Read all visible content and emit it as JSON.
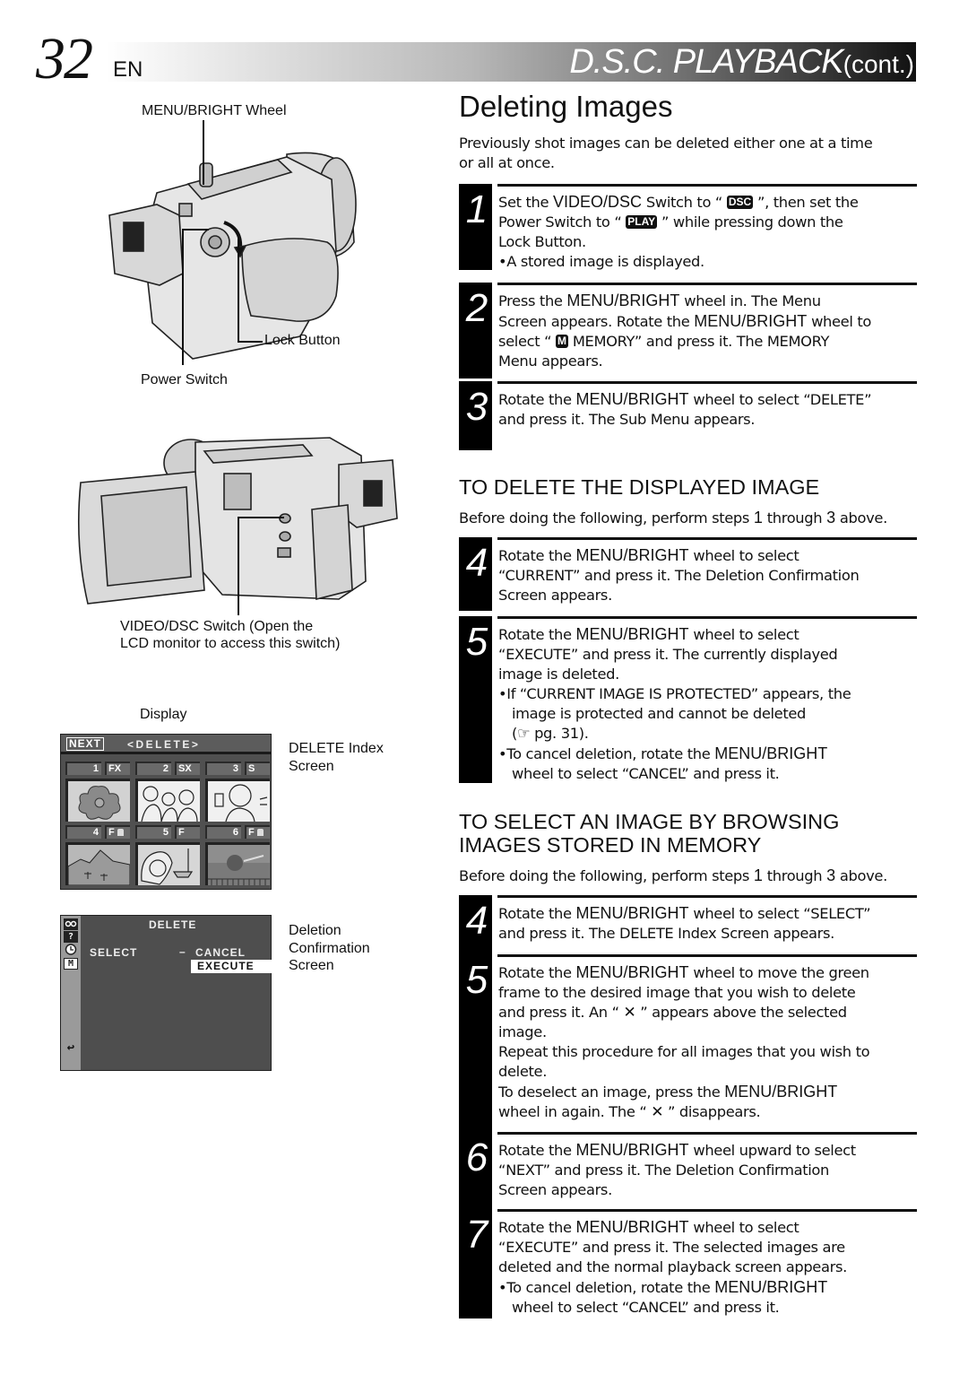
{
  "header": {
    "page_number": "32",
    "language": "EN",
    "section_title": "D.S.C.  PLAYBACK",
    "section_suffix": "(cont.)"
  },
  "figures": {
    "camera_top": {
      "label_wheel": "MENU/BRIGHT Wheel",
      "label_lock": "Lock Button",
      "label_power": "Power Switch"
    },
    "camera_lcd": {
      "label_switch_line1": "VIDEO/DSC Switch (Open the",
      "label_switch_line2": "LCD monitor to access this switch)"
    },
    "display_label": "Display",
    "delete_index_screen": {
      "caption_line1": "DELETE Index",
      "caption_line2": "Screen",
      "next_label": "NEXT",
      "title": "<DELETE>",
      "thumbnails": [
        {
          "number": "1",
          "mode": "FX",
          "protected": false,
          "subject": "flower"
        },
        {
          "number": "2",
          "mode": "SX",
          "protected": false,
          "subject": "group of people"
        },
        {
          "number": "3",
          "mode": "S",
          "protected": false,
          "subject": "woman with drink"
        },
        {
          "number": "4",
          "mode": "F",
          "protected": true,
          "subject": "mountains"
        },
        {
          "number": "5",
          "mode": "F",
          "protected": false,
          "subject": "woman with hat"
        },
        {
          "number": "6",
          "mode": "F",
          "protected": true,
          "subject": "sunset over sea"
        }
      ]
    },
    "confirmation_screen": {
      "caption_line1": "Deletion",
      "caption_line2": "Confirmation",
      "caption_line3": "Screen",
      "title": "DELETE",
      "left_option": "SELECT",
      "dash": "–",
      "options": [
        "CANCEL",
        "EXECUTE"
      ],
      "highlighted_option": "EXECUTE",
      "side_icons": [
        "tape-icon",
        "camera-question-icon",
        "clock-icon",
        "memory-icon",
        "return-icon"
      ],
      "memory_icon_glyph": "M",
      "return_icon_glyph": "↩"
    }
  },
  "main": {
    "title": "Deleting Images",
    "intro_line1": "Previously shot images can be deleted either one at a time",
    "intro_line2": "or all at once.",
    "steps_common": [
      {
        "number": "1",
        "lines": [
          [
            "Set the ",
            {
              "b": "VIDEO/DSC"
            },
            " Switch to “ ",
            {
              "chip": "DSC"
            },
            " ”, then set the"
          ],
          [
            "Power Switch to “ ",
            {
              "chip": "PLAY"
            },
            " ” while pressing down the"
          ],
          [
            "Lock Button."
          ],
          [
            "•A stored image is displayed."
          ]
        ]
      },
      {
        "number": "2",
        "lines": [
          [
            "Press the ",
            {
              "b": "MENU/BRIGHT"
            },
            " wheel in. The Menu"
          ],
          [
            "Screen appears. Rotate the ",
            {
              "b": "MENU/BRIGHT"
            },
            " wheel to"
          ],
          [
            "select “ ",
            {
              "chip": "M"
            },
            "  MEMORY” and press it. The MEMORY"
          ],
          [
            "Menu appears."
          ]
        ]
      },
      {
        "number": "3",
        "lines": [
          [
            "Rotate the ",
            {
              "b": "MENU/BRIGHT"
            },
            " wheel to select “DELETE”"
          ],
          [
            "and press it. The Sub Menu appears."
          ]
        ]
      }
    ],
    "section_current": {
      "heading": "TO DELETE THE DISPLAYED IMAGE",
      "note_parts": [
        "Before doing the following, perform steps ",
        "1",
        " through ",
        "3",
        " above."
      ],
      "steps": [
        {
          "number": "4",
          "lines": [
            [
              "Rotate the ",
              {
                "b": "MENU/BRIGHT"
              },
              " wheel to select"
            ],
            [
              "“CURRENT” and press it. The Deletion Confirmation"
            ],
            [
              "Screen appears."
            ]
          ]
        },
        {
          "number": "5",
          "lines": [
            [
              "Rotate the ",
              {
                "b": "MENU/BRIGHT"
              },
              " wheel to select"
            ],
            [
              "“EXECUTE” and press it. The currently displayed"
            ],
            [
              "image is deleted."
            ],
            [
              "•If “CURRENT IMAGE IS PROTECTED” appears, the"
            ],
            [
              {
                "ind": "image is protected and cannot be deleted"
              }
            ],
            [
              {
                "ind": "(☞ pg. 31)."
              }
            ],
            [
              "•To cancel deletion, rotate the ",
              {
                "b": "MENU/BRIGHT"
              }
            ],
            [
              {
                "ind": "wheel to select “CANCEL” and press it."
              }
            ]
          ]
        }
      ]
    },
    "section_browse": {
      "heading_line1": "TO SELECT AN IMAGE BY BROWSING",
      "heading_line2": "IMAGES STORED IN MEMORY",
      "note_parts": [
        "Before doing the following, perform steps ",
        "1",
        " through ",
        "3",
        " above."
      ],
      "steps": [
        {
          "number": "4",
          "lines": [
            [
              "Rotate the ",
              {
                "b": "MENU/BRIGHT"
              },
              " wheel to select “SELECT”"
            ],
            [
              "and press it. The DELETE Index Screen appears."
            ]
          ]
        },
        {
          "number": "5",
          "lines": [
            [
              "Rotate the ",
              {
                "b": "MENU/BRIGHT"
              },
              " wheel to move the green"
            ],
            [
              "frame to the desired image that you wish to delete"
            ],
            [
              "and press it. An “ ",
              {
                "x": "✕"
              },
              " ” appears above the selected"
            ],
            [
              "image."
            ],
            [
              "Repeat this procedure for all images that you wish to"
            ],
            [
              "delete."
            ],
            [
              "To deselect an image, press the ",
              {
                "b": "MENU/BRIGHT"
              }
            ],
            [
              "wheel in again. The “ ",
              {
                "x": "✕"
              },
              " ” disappears."
            ]
          ]
        },
        {
          "number": "6",
          "lines": [
            [
              "Rotate the ",
              {
                "b": "MENU/BRIGHT"
              },
              " wheel upward to select"
            ],
            [
              "“NEXT” and press it. The Deletion Confirmation"
            ],
            [
              "Screen appears."
            ]
          ]
        },
        {
          "number": "7",
          "lines": [
            [
              "Rotate the ",
              {
                "b": "MENU/BRIGHT"
              },
              " wheel to select"
            ],
            [
              "“EXECUTE” and press it. The selected images are"
            ],
            [
              "deleted and the normal playback screen appears."
            ],
            [
              "•To cancel deletion, rotate the ",
              {
                "b": "MENU/BRIGHT"
              }
            ],
            [
              {
                "ind": "wheel to select “CANCEL” and press it."
              }
            ]
          ]
        }
      ]
    }
  }
}
